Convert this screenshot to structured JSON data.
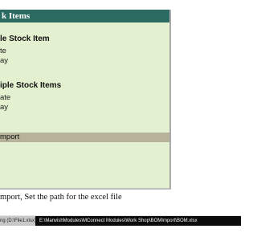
{
  "panel": {
    "title": "k Items",
    "sections": [
      {
        "heading": "le Stock Item",
        "items": [
          "te",
          "ay"
        ]
      },
      {
        "heading": "iple Stock Items",
        "items": [
          "ate",
          "ay"
        ]
      }
    ],
    "selected_item": "mport"
  },
  "caption": "mport, Set the path for the excel file",
  "path_field": {
    "label": "ng (D:\\File1.xlsx)",
    "value": "E:\\ManvishModules\\MConnect Modules\\Work Shop\\BOMImport\\BOM.xlsx"
  },
  "colors": {
    "header_bg": "#2b6b62",
    "panel_bg": "#e4f1d0",
    "selected_bg": "#b6b39a",
    "path_field_bg": "#0b0b0b"
  }
}
